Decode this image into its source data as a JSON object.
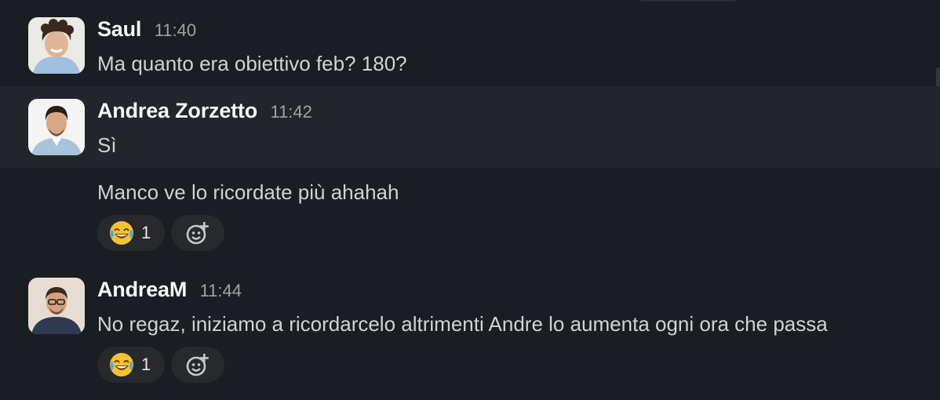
{
  "messages": [
    {
      "author": "Saul",
      "time": "11:40",
      "text": "Ma quanto era obiettivo feb? 180?"
    },
    {
      "author": "Andrea Zorzetto",
      "time": "11:42",
      "text": "Sì",
      "continuation": "Manco ve lo ricordate più ahahah",
      "reaction": {
        "emoji": "joy-emoji",
        "count": "1"
      }
    },
    {
      "author": "AndreaM",
      "time": "11:44",
      "text": "No regaz, iniziamo a ricordarcelo altrimenti Andre lo aumenta ogni ora che passa",
      "reaction": {
        "emoji": "joy-emoji",
        "count": "1"
      }
    }
  ],
  "icons": {
    "add_reaction": "add-reaction-icon"
  },
  "colors": {
    "background": "#1a1d21",
    "hover_row": "#222529",
    "reaction_bg": "#27292d"
  }
}
